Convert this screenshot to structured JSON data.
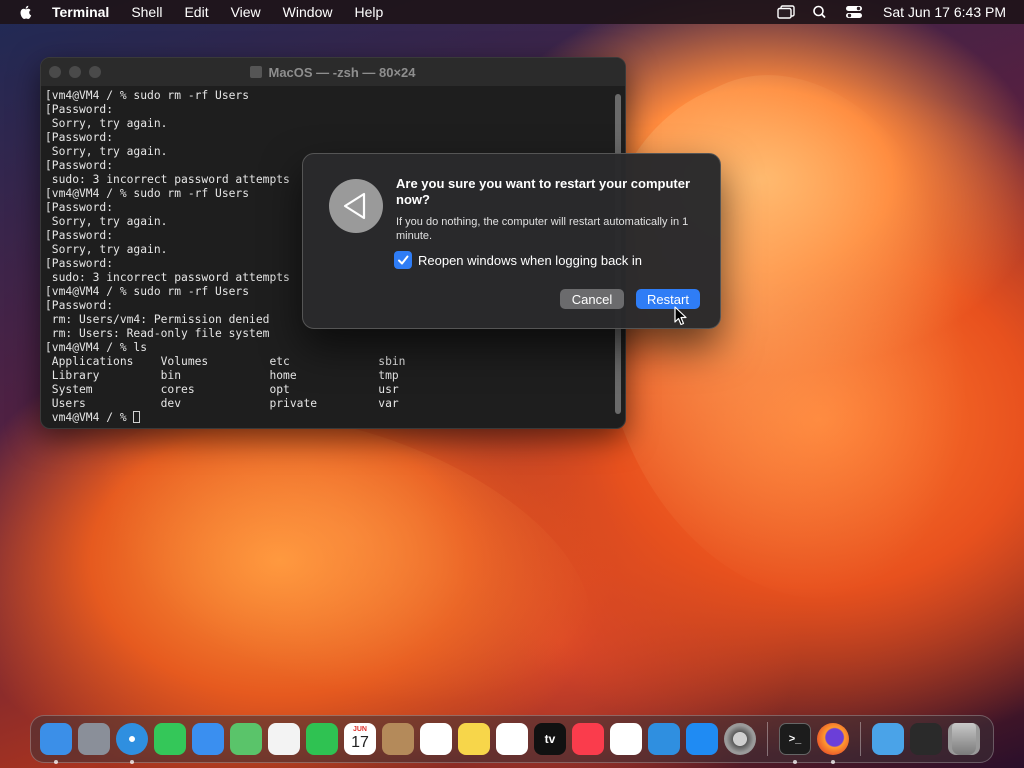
{
  "menubar": {
    "app_name": "Terminal",
    "menus": [
      "Shell",
      "Edit",
      "View",
      "Window",
      "Help"
    ],
    "clock": "Sat Jun 17  6:43 PM"
  },
  "terminal": {
    "title": "MacOS — -zsh — 80×24",
    "lines": [
      "[vm4@VM4 / % sudo rm -rf Users",
      "[Password:",
      " Sorry, try again.",
      "[Password:",
      " Sorry, try again.",
      "[Password:",
      " sudo: 3 incorrect password attempts",
      "[vm4@VM4 / % sudo rm -rf Users",
      "[Password:",
      " Sorry, try again.",
      "[Password:",
      " Sorry, try again.",
      "[Password:",
      " sudo: 3 incorrect password attempts",
      "[vm4@VM4 / % sudo rm -rf Users",
      "[Password:",
      " rm: Users/vm4: Permission denied",
      " rm: Users: Read-only file system",
      "[vm4@VM4 / % ls",
      " Applications    Volumes         etc             sbin",
      " Library         bin             home            tmp",
      " System          cores           opt             usr",
      " Users           dev             private         var"
    ],
    "prompt": " vm4@VM4 / % "
  },
  "dialog": {
    "title": "Are you sure you want to restart your computer now?",
    "message": "If you do nothing, the computer will restart automatically in 1 minute.",
    "checkbox_label": "Reopen windows when logging back in",
    "checkbox_checked": true,
    "cancel_label": "Cancel",
    "restart_label": "Restart"
  },
  "dock": {
    "calendar_month": "JUN",
    "calendar_day": "17",
    "tv_label": "tv",
    "apps": [
      {
        "name": "finder",
        "color": "#3b8fe8",
        "running": true
      },
      {
        "name": "launchpad",
        "color": "#8a8f99",
        "running": false
      },
      {
        "name": "safari",
        "color": "#2f8fe0",
        "running": true
      },
      {
        "name": "messages",
        "color": "#34c759",
        "running": false
      },
      {
        "name": "mail",
        "color": "#3a8ff0",
        "running": false
      },
      {
        "name": "maps",
        "color": "#5ac46a",
        "running": false
      },
      {
        "name": "photos",
        "color": "#f3f3f3",
        "running": false
      },
      {
        "name": "facetime",
        "color": "#2fc252",
        "running": false
      },
      {
        "name": "calendar",
        "color": "#ffffff",
        "running": false
      },
      {
        "name": "contacts",
        "color": "#b48a5a",
        "running": false
      },
      {
        "name": "reminders",
        "color": "#ffffff",
        "running": false
      },
      {
        "name": "notes",
        "color": "#f7d64a",
        "running": false
      },
      {
        "name": "freeform",
        "color": "#ffffff",
        "running": false
      },
      {
        "name": "apple-tv",
        "color": "#111111",
        "running": false
      },
      {
        "name": "music",
        "color": "#fa3c4c",
        "running": false
      },
      {
        "name": "news",
        "color": "#ffffff",
        "running": false
      },
      {
        "name": "keynote",
        "color": "#2f8fe0",
        "running": false
      },
      {
        "name": "app-store",
        "color": "#1f8bf3",
        "running": false
      },
      {
        "name": "system-settings",
        "color": "#8e8e93",
        "running": false
      },
      {
        "name": "terminal",
        "color": "#1c1c1c",
        "running": true
      },
      {
        "name": "firefox",
        "color": "#e8572a",
        "running": true
      },
      {
        "name": "downloads-folder",
        "color": "#4aa3e8",
        "running": false
      },
      {
        "name": "screenshot-stack",
        "color": "#2a2a2a",
        "running": false
      },
      {
        "name": "trash",
        "color": "#9a9a9a",
        "running": false
      }
    ]
  }
}
